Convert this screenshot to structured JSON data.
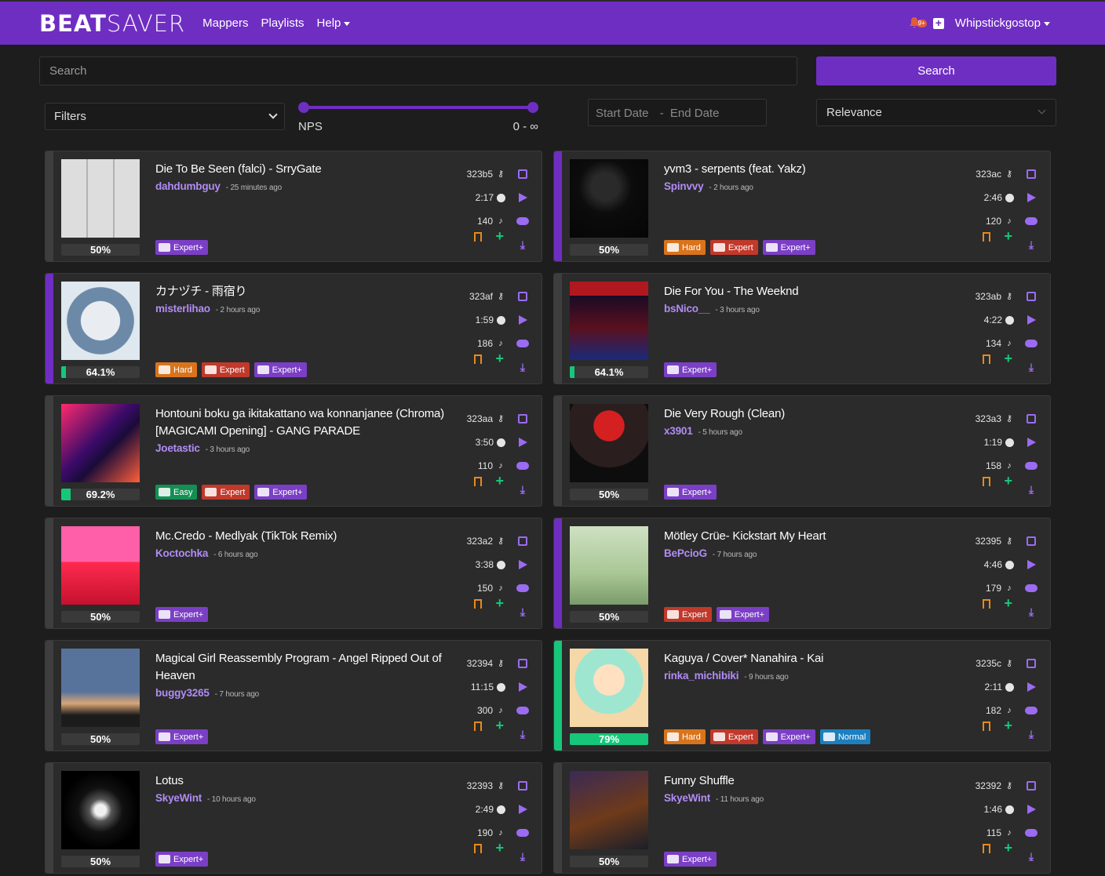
{
  "nav": {
    "brand_bold": "BEAT",
    "brand_light": "SAVER",
    "links": [
      "Mappers",
      "Playlists",
      "Help"
    ],
    "notif_count": "9+",
    "user": "Whipstickgostop"
  },
  "search": {
    "placeholder": "Search",
    "button": "Search"
  },
  "filters": {
    "filters_label": "Filters",
    "nps_label": "NPS",
    "nps_range": "0 - ∞",
    "start_date": "Start Date",
    "end_date": "End Date",
    "sort": "Relevance"
  },
  "colors": {
    "accent": "#6f2ec2",
    "rating_fill": "#16c77a",
    "mapper": "#b18cf5"
  },
  "cards": [
    {
      "title": "Die To Be Seen (falci) - SrryGate",
      "mapper": "dahdumbguy",
      "ago": "25 minutes ago",
      "key": "323b5",
      "duration": "2:17",
      "nps": "140",
      "rating": "50%",
      "rating_fill": 0,
      "accent": "none",
      "diffs": [
        [
          "Expert+",
          "expertplus"
        ]
      ]
    },
    {
      "title": "yvm3 - serpents (feat. Yakz)",
      "mapper": "Spinvvy",
      "ago": "2 hours ago",
      "key": "323ac",
      "duration": "2:46",
      "nps": "120",
      "rating": "50%",
      "rating_fill": 0,
      "accent": "purple",
      "diffs": [
        [
          "Hard",
          "hard"
        ],
        [
          "Expert",
          "expert"
        ],
        [
          "Expert+",
          "expertplus"
        ]
      ]
    },
    {
      "title": "カナヅチ - 雨宿り",
      "mapper": "misterlihao",
      "ago": "2 hours ago",
      "key": "323af",
      "duration": "1:59",
      "nps": "186",
      "rating": "64.1%",
      "rating_fill": 0.064,
      "accent": "purple",
      "diffs": [
        [
          "Hard",
          "hard"
        ],
        [
          "Expert",
          "expert"
        ],
        [
          "Expert+",
          "expertplus"
        ]
      ]
    },
    {
      "title": "Die For You - The Weeknd",
      "mapper": "bsNico__",
      "ago": "3 hours ago",
      "key": "323ab",
      "duration": "4:22",
      "nps": "134",
      "rating": "64.1%",
      "rating_fill": 0.064,
      "accent": "none",
      "diffs": [
        [
          "Expert+",
          "expertplus"
        ]
      ]
    },
    {
      "title": "Hontouni boku ga ikitakattano wa konnanjanee (Chroma) [MAGICAMI Opening] - GANG PARADE",
      "mapper": "Joetastic",
      "ago": "3 hours ago",
      "key": "323aa",
      "duration": "3:50",
      "nps": "110",
      "rating": "69.2%",
      "rating_fill": 0.12,
      "accent": "none",
      "diffs": [
        [
          "Easy",
          "easy"
        ],
        [
          "Expert",
          "expert"
        ],
        [
          "Expert+",
          "expertplus"
        ]
      ]
    },
    {
      "title": "Die Very Rough (Clean)",
      "mapper": "x3901",
      "ago": "5 hours ago",
      "key": "323a3",
      "duration": "1:19",
      "nps": "158",
      "rating": "50%",
      "rating_fill": 0,
      "accent": "none",
      "diffs": [
        [
          "Expert+",
          "expertplus"
        ]
      ]
    },
    {
      "title": "Mc.Credo - Medlyak (TikTok Remix)",
      "mapper": "Koctochka",
      "ago": "6 hours ago",
      "key": "323a2",
      "duration": "3:38",
      "nps": "150",
      "rating": "50%",
      "rating_fill": 0,
      "accent": "none",
      "diffs": [
        [
          "Expert+",
          "expertplus"
        ]
      ]
    },
    {
      "title": "Mötley Crüe- Kickstart My Heart",
      "mapper": "BePcioG",
      "ago": "7 hours ago",
      "key": "32395",
      "duration": "4:46",
      "nps": "179",
      "rating": "50%",
      "rating_fill": 0,
      "accent": "purple",
      "diffs": [
        [
          "Expert",
          "expert"
        ],
        [
          "Expert+",
          "expertplus"
        ]
      ]
    },
    {
      "title": "Magical Girl Reassembly Program - Angel Ripped Out of Heaven",
      "mapper": "buggy3265",
      "ago": "7 hours ago",
      "key": "32394",
      "duration": "11:15",
      "nps": "300",
      "rating": "50%",
      "rating_fill": 0,
      "accent": "none",
      "diffs": [
        [
          "Expert+",
          "expertplus"
        ]
      ]
    },
    {
      "title": "Kaguya / Cover* Nanahira - Kai",
      "mapper": "rinka_michibiki",
      "ago": "9 hours ago",
      "key": "3235c",
      "duration": "2:11",
      "nps": "182",
      "rating": "79%",
      "rating_fill": 1.0,
      "accent": "green",
      "diffs": [
        [
          "Hard",
          "hard"
        ],
        [
          "Expert",
          "expert"
        ],
        [
          "Expert+",
          "expertplus"
        ],
        [
          "Normal",
          "normal"
        ]
      ]
    },
    {
      "title": "Lotus",
      "mapper": "SkyeWint",
      "ago": "10 hours ago",
      "key": "32393",
      "duration": "2:49",
      "nps": "190",
      "rating": "50%",
      "rating_fill": 0,
      "accent": "none",
      "diffs": [
        [
          "Expert+",
          "expertplus"
        ]
      ]
    },
    {
      "title": "Funny Shuffle",
      "mapper": "SkyeWint",
      "ago": "11 hours ago",
      "key": "32392",
      "duration": "1:46",
      "nps": "115",
      "rating": "50%",
      "rating_fill": 0,
      "accent": "none",
      "diffs": [
        [
          "Expert+",
          "expertplus"
        ]
      ]
    }
  ]
}
